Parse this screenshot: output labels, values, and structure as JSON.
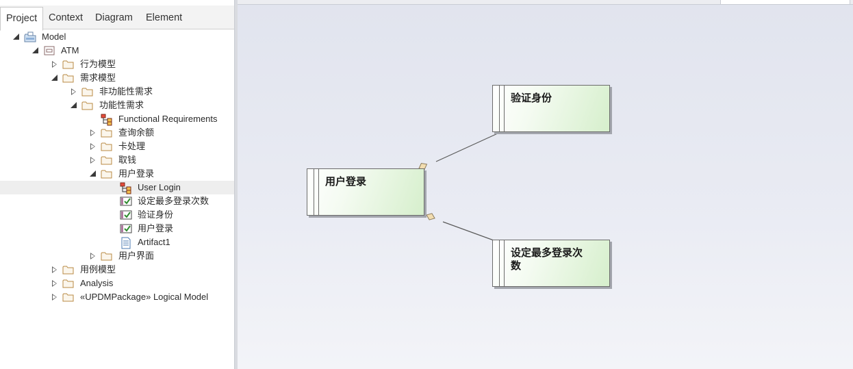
{
  "tabs": [
    {
      "label": "Project",
      "active": true
    },
    {
      "label": "Context"
    },
    {
      "label": "Diagram"
    },
    {
      "label": "Element"
    }
  ],
  "tree": [
    {
      "label": "Model",
      "icon": "model-root-icon",
      "toggle": "expanded"
    },
    {
      "label": "ATM",
      "icon": "package-view-icon",
      "toggle": "expanded"
    },
    {
      "label": "行为模型",
      "icon": "folder-icon",
      "toggle": "collapsed"
    },
    {
      "label": "需求模型",
      "icon": "folder-icon",
      "toggle": "expanded"
    },
    {
      "label": "非功能性需求",
      "icon": "folder-icon",
      "toggle": "collapsed"
    },
    {
      "label": "功能性需求",
      "icon": "folder-icon",
      "toggle": "expanded"
    },
    {
      "label": "Functional Requirements",
      "icon": "requirements-diagram-icon",
      "toggle": "none"
    },
    {
      "label": "查询余额",
      "icon": "folder-icon",
      "toggle": "collapsed"
    },
    {
      "label": "卡处理",
      "icon": "folder-icon",
      "toggle": "collapsed"
    },
    {
      "label": "取钱",
      "icon": "folder-icon",
      "toggle": "collapsed"
    },
    {
      "label": "用户登录",
      "icon": "folder-icon",
      "toggle": "expanded"
    },
    {
      "label": "User Login",
      "icon": "requirements-diagram-icon",
      "toggle": "none",
      "selected": true
    },
    {
      "label": "设定最多登录次数",
      "icon": "requirement-check-icon",
      "toggle": "none"
    },
    {
      "label": "验证身份",
      "icon": "requirement-check-icon",
      "toggle": "none"
    },
    {
      "label": "用户登录",
      "icon": "requirement-check-icon",
      "toggle": "none"
    },
    {
      "label": "Artifact1",
      "icon": "document-artifact-icon",
      "toggle": "none"
    },
    {
      "label": "用户界面",
      "icon": "folder-icon",
      "toggle": "collapsed"
    },
    {
      "label": "用例模型",
      "icon": "folder-icon",
      "toggle": "collapsed"
    },
    {
      "label": "Analysis",
      "icon": "folder-icon",
      "toggle": "collapsed"
    },
    {
      "label": "«UPDMPackage» Logical Model",
      "icon": "folder-icon",
      "toggle": "collapsed"
    }
  ],
  "diagram": {
    "requirements": [
      {
        "id": "verify",
        "label": "验证身份"
      },
      {
        "id": "login",
        "label": "用户登录"
      },
      {
        "id": "maxlogin",
        "label": "设定最多登录次数"
      }
    ],
    "connectors": [
      {
        "from": "login",
        "to": "verify",
        "type": "aggregation"
      },
      {
        "from": "login",
        "to": "maxlogin",
        "type": "aggregation"
      }
    ],
    "colors": {
      "element_fill_end": "#d6efcc",
      "diamond_fill": "#f2ddb0",
      "background": "#e4e7f0"
    }
  }
}
